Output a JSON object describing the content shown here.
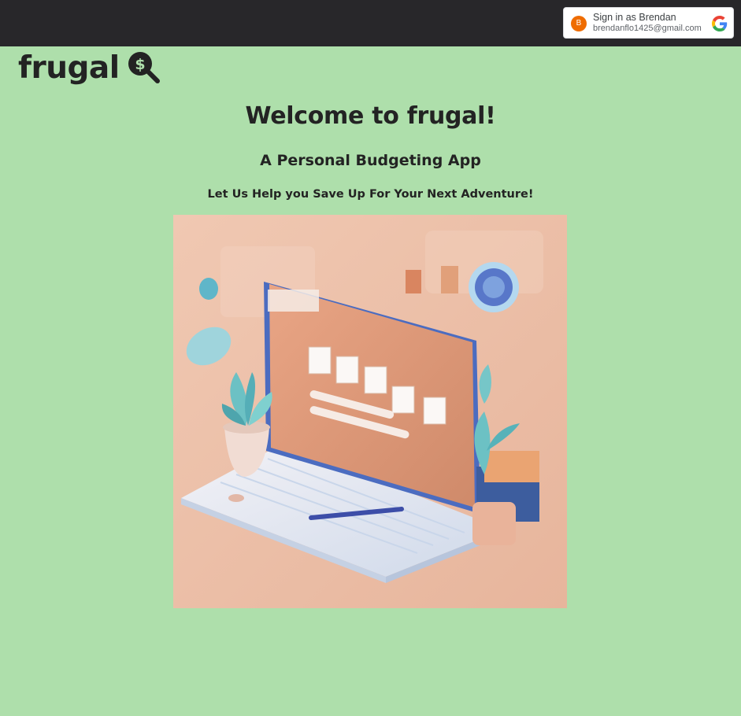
{
  "google_signin": {
    "avatar_initial": "B",
    "name_line": "Sign in as Brendan",
    "email": "brendanflo1425@gmail.com",
    "icon": "google-g-icon"
  },
  "brand": {
    "name": "frugal",
    "icon": "dollar-magnifier-icon"
  },
  "hero": {
    "title": "Welcome to frugal!",
    "subtitle": "A Personal Budgeting App",
    "tagline": "Let Us Help you Save Up For Your Next Adventure!",
    "image": "budgeting-laptop-illustration"
  },
  "colors": {
    "page_background": "#aedfab",
    "topbar": "#28272a",
    "text": "#232323",
    "avatar": "#ef6c00"
  }
}
